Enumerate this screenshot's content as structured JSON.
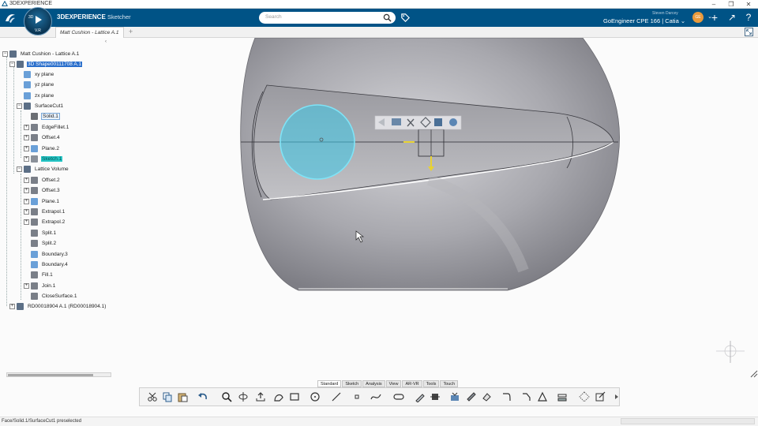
{
  "window": {
    "title": "3DEXPERIENCE",
    "minimize_glyph": "–",
    "restore_glyph": "❐",
    "close_glyph": "✕"
  },
  "topbar": {
    "brand_strong": "3DEXPERIENCE",
    "brand_app": "Sketcher",
    "search_placeholder": "Search",
    "user_name": "Steven Darcey",
    "role": "GoEngineer CPE 166 | Catia",
    "compass_version": "V.R",
    "compass_q": "3D",
    "avatar_initials": "GE",
    "add_glyph": "+",
    "share_glyph": "↗",
    "help_glyph": "?",
    "dropdown_glyph": "⌄"
  },
  "tabs": {
    "active": "Matt Cushion - Lattice A.1",
    "add_glyph": "+"
  },
  "tree": {
    "collapse_glyph": "‹",
    "items": [
      {
        "label": "Matt Cushion - Lattice A.1",
        "state": "normal"
      },
      {
        "label": "3D Shape00111708 A.1",
        "state": "sel"
      },
      {
        "label": "xy plane",
        "state": "normal"
      },
      {
        "label": "yz plane",
        "state": "normal"
      },
      {
        "label": "zx plane",
        "state": "normal"
      },
      {
        "label": "SurfaceCut1",
        "state": "normal"
      },
      {
        "label": "Solid.1",
        "state": "boxed"
      },
      {
        "label": "EdgeFillet.1",
        "state": "normal"
      },
      {
        "label": "Offset.4",
        "state": "normal"
      },
      {
        "label": "Plane.2",
        "state": "normal"
      },
      {
        "label": "Sketch.1",
        "state": "hl"
      },
      {
        "label": "Lattice Volume",
        "state": "normal"
      },
      {
        "label": "Offset.2",
        "state": "normal"
      },
      {
        "label": "Offset.3",
        "state": "normal"
      },
      {
        "label": "Plane.1",
        "state": "normal"
      },
      {
        "label": "Extrapol.1",
        "state": "normal"
      },
      {
        "label": "Extrapol.2",
        "state": "normal"
      },
      {
        "label": "Split.1",
        "state": "normal"
      },
      {
        "label": "Split.2",
        "state": "normal"
      },
      {
        "label": "Boundary.3",
        "state": "normal"
      },
      {
        "label": "Boundary.4",
        "state": "normal"
      },
      {
        "label": "Fill.1",
        "state": "normal"
      },
      {
        "label": "Join.1",
        "state": "normal"
      },
      {
        "label": "CloseSurface.1",
        "state": "normal"
      },
      {
        "label": "RD00018904 A.1 (RD00018904.1)",
        "state": "normal"
      }
    ]
  },
  "command_tabs": [
    "Standard",
    "Sketch",
    "Analysis",
    "View",
    "AR-VR",
    "Tools",
    "Touch"
  ],
  "status": "Face/Solid.1/SurfaceCut1 preselected",
  "colors": {
    "topbar": "#005386",
    "selection": "#2a6fcc",
    "sketch_highlight": "#26c6c6",
    "preselect_circle": "#3cc8e8"
  },
  "expander": {
    "plus": "+",
    "minus": "−"
  }
}
